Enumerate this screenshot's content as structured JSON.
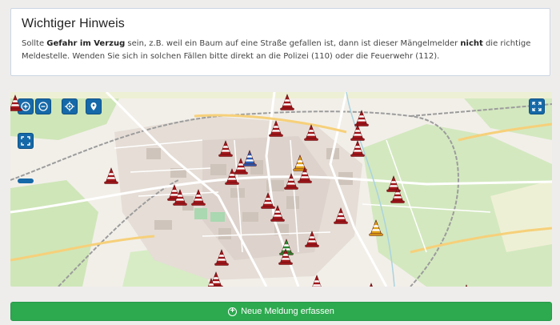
{
  "notice": {
    "title": "Wichtiger Hinweis",
    "text_1": "Sollte ",
    "text_bold_1": "Gefahr im Verzug",
    "text_2": " sein, z.B. weil ein Baum auf eine Straße gefallen ist, dann ist dieser Mängelmelder ",
    "text_bold_2": "nicht",
    "text_3": " die richtige Meldestelle. Wenden Sie sich in solchen Fällen bitte direkt an die Polizei (110) oder die Feuerwehr (112)."
  },
  "map": {
    "controls": [
      {
        "name": "zoom-in-button",
        "icon": "plus-icon"
      },
      {
        "name": "zoom-out-button",
        "icon": "minus-icon"
      },
      {
        "name": "locate-button",
        "icon": "crosshair-icon"
      },
      {
        "name": "add-marker-button",
        "icon": "map-pin-icon"
      },
      {
        "name": "fullscreen-button",
        "icon": "expand-icon"
      },
      {
        "name": "fit-extent-button",
        "icon": "corners-icon"
      }
    ],
    "colors": {
      "marker_red": "#a3171b",
      "marker_yellow": "#e0a31a",
      "marker_blue": "#2b5fb8",
      "marker_green": "#2f8a36",
      "control_blue": "#1669a8",
      "green_area": "#cfe6b8",
      "railway": "#9c9c9c",
      "road_major": "#f6d07a"
    },
    "marker_icon": "traffic-cone-icon"
  },
  "create_button": {
    "label": "Neue Meldung erfassen",
    "icon": "plus-circle-icon"
  }
}
